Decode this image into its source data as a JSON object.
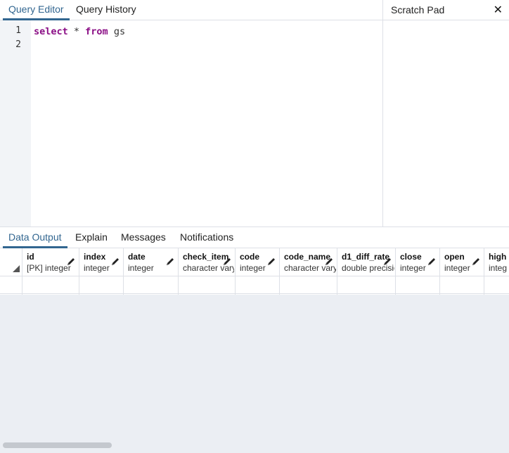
{
  "editor_tabs": [
    {
      "label": "Query Editor",
      "active": true
    },
    {
      "label": "Query History",
      "active": false
    }
  ],
  "scratch_pad": {
    "title": "Scratch Pad",
    "close_glyph": "✕"
  },
  "editor": {
    "line_numbers": [
      "1",
      "2"
    ],
    "code": {
      "kw1": "select",
      "star": " * ",
      "kw2": "from",
      "table": " gs"
    }
  },
  "result_tabs": [
    {
      "label": "Data Output",
      "active": true
    },
    {
      "label": "Explain",
      "active": false
    },
    {
      "label": "Messages",
      "active": false
    },
    {
      "label": "Notifications",
      "active": false
    }
  ],
  "columns": [
    {
      "name": "id",
      "type": "[PK] integer"
    },
    {
      "name": "index",
      "type": "integer"
    },
    {
      "name": "date",
      "type": "integer"
    },
    {
      "name": "check_item",
      "type": "character vary"
    },
    {
      "name": "code",
      "type": "integer"
    },
    {
      "name": "code_name",
      "type": "character vary"
    },
    {
      "name": "d1_diff_rate",
      "type": "double precisio"
    },
    {
      "name": "close",
      "type": "integer"
    },
    {
      "name": "open",
      "type": "integer"
    },
    {
      "name": "high",
      "type": "integ"
    }
  ],
  "icons": {
    "edit": "pencil-icon",
    "close": "close-icon",
    "sort": "sort-corner-icon"
  },
  "colors": {
    "accent": "#326690",
    "keyword": "#8b0f86",
    "panel_bg": "#ebeef3"
  }
}
